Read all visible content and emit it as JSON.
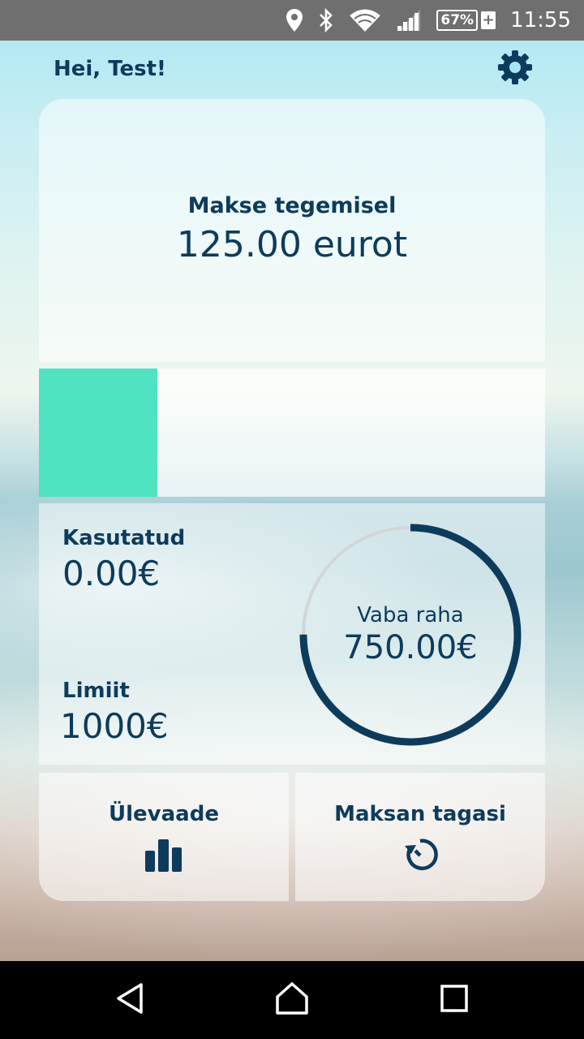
{
  "status_bar": {
    "icons": [
      "location-icon",
      "bluetooth-icon",
      "wifi-icon",
      "signal-icon"
    ],
    "battery": "67%",
    "battery_charging_symbol": "+",
    "time": "11:55"
  },
  "header": {
    "greeting": "Hei, Test!",
    "settings_icon": "gear-icon"
  },
  "payment": {
    "label": "Makse tegemisel",
    "amount": "125.00 eurot"
  },
  "progress": {
    "fraction": 0.234,
    "color": "#4fe3c1"
  },
  "stats": {
    "used_label": "Kasutatud",
    "used_value": "0.00€",
    "limit_label": "Limiit",
    "limit_value": "1000€",
    "free_label": "Vaba raha",
    "free_value": "750.00€",
    "ring_fraction": 0.75,
    "ring_color": "#0d3b5c",
    "ring_track_color": "#d3d6d8"
  },
  "actions": {
    "overview_label": "Ülevaade",
    "overview_icon": "bar-chart-icon",
    "repay_label": "Maksan tagasi",
    "repay_icon": "refresh-icon"
  },
  "navbar": {
    "icons": [
      "back-icon",
      "home-icon",
      "recents-icon"
    ]
  },
  "colors": {
    "primary": "#0d3b5c",
    "accent": "#4fe3c1"
  }
}
